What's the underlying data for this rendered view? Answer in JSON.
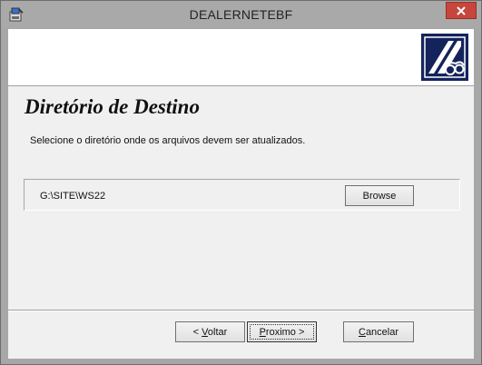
{
  "window": {
    "title": "DEALERNETEBF",
    "icons": {
      "app": "installer-icon",
      "close": "close-icon"
    }
  },
  "header": {
    "logo": "company-logo"
  },
  "page": {
    "title": "Diretório de Destino",
    "subtitle": "Selecione o diretório onde os arquivos devem ser atualizados."
  },
  "destination": {
    "path": "G:\\SITE\\WS22",
    "browse_label": "Browse"
  },
  "footer": {
    "back": {
      "accel": "<",
      "rest": " Voltar",
      "accel_letter": "V"
    },
    "next": {
      "accel": "P",
      "rest": "roximo >"
    },
    "cancel": {
      "accel": "C",
      "rest": "ancelar"
    }
  },
  "colors": {
    "titlebar": "#a9a9a9",
    "close_button": "#c7463c",
    "logo_background": "#14235c"
  }
}
